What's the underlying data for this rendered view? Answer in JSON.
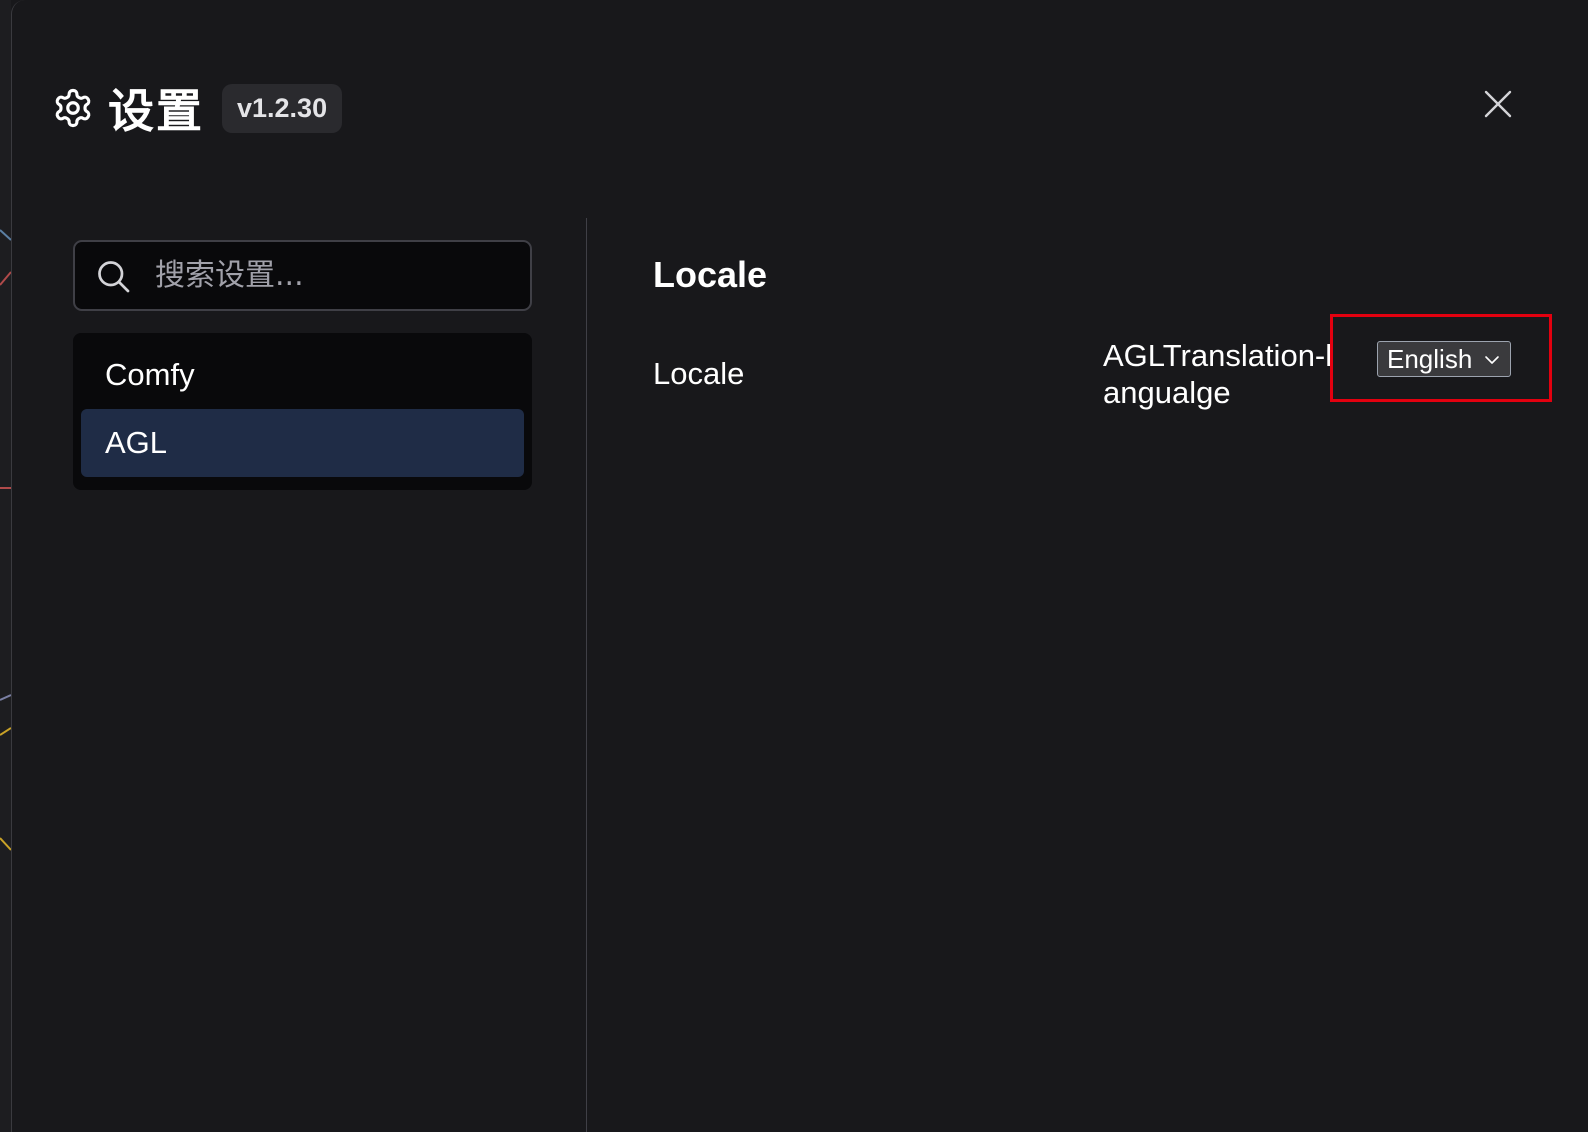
{
  "header": {
    "title": "设置",
    "version": "v1.2.30",
    "icon": "gear-icon",
    "close_icon": "close-icon"
  },
  "sidebar": {
    "search": {
      "placeholder": "搜索设置...",
      "value": "",
      "icon": "search-icon"
    },
    "items": [
      {
        "label": "Comfy",
        "active": false
      },
      {
        "label": "AGL",
        "active": true
      }
    ]
  },
  "main": {
    "section_title": "Locale",
    "settings": [
      {
        "row_label": "Locale",
        "name": "AGLTranslation-langualge",
        "select": {
          "selected": "English",
          "icon": "chevron-down-icon"
        }
      }
    ]
  },
  "colors": {
    "background": "#18181b",
    "active_item": "#1f2c46",
    "highlight": "#e3000f"
  }
}
